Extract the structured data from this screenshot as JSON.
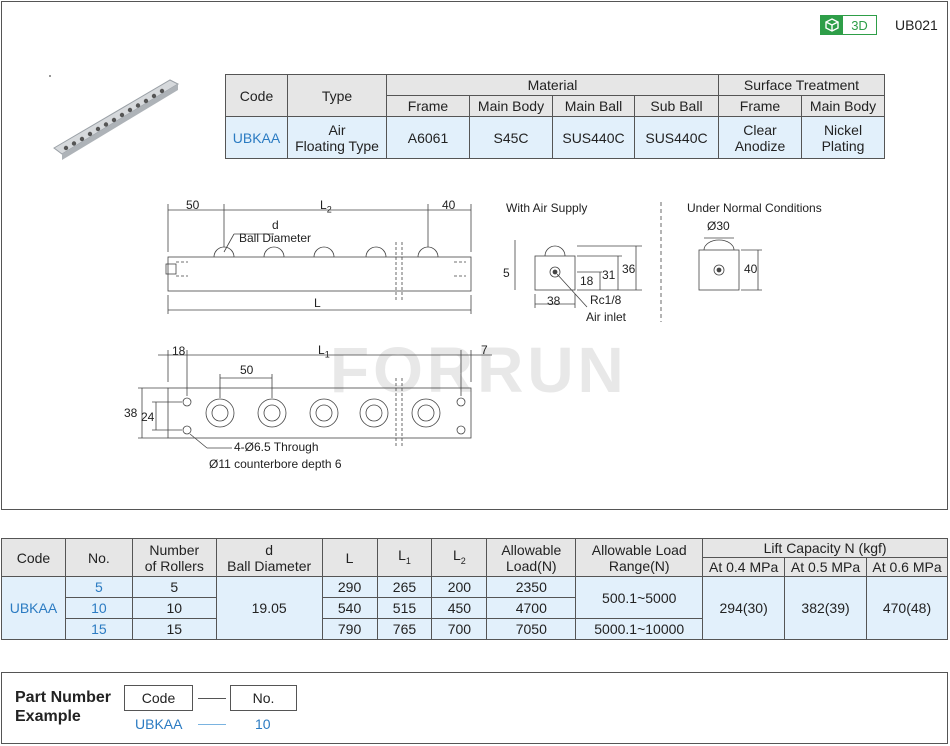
{
  "header": {
    "badge_label": "3D",
    "series_code": "UB021",
    "brand_watermark": "FORRUN",
    "badge_color": "#2e9e48"
  },
  "material_table": {
    "headers": {
      "code": "Code",
      "type": "Type",
      "material": "Material",
      "surface": "Surface Treatment"
    },
    "subheaders": {
      "frame": "Frame",
      "main_body": "Main Body",
      "main_ball": "Main Ball",
      "sub_ball": "Sub Ball",
      "st_frame": "Frame",
      "st_main_body": "Main Body"
    },
    "row": {
      "code": "UBKAA",
      "type_l1": "Air",
      "type_l2": "Floating Type",
      "frame": "A6061",
      "main_body": "S45C",
      "main_ball": "SUS440C",
      "sub_ball": "SUS440C",
      "st_frame_l1": "Clear",
      "st_frame_l2": "Anodize",
      "st_body_l1": "Nickel",
      "st_body_l2": "Plating"
    }
  },
  "drawing": {
    "side": {
      "dim_50": "50",
      "dim_L2": "L",
      "dim_L2_sub": "2",
      "dim_40": "40",
      "d_label": "d",
      "ball_diameter": "Ball Diameter",
      "dim_L": "L"
    },
    "air_supply": {
      "title": "With Air Supply",
      "dim_5": "5",
      "dim_18": "18",
      "dim_31": "31",
      "dim_36": "36",
      "dim_38": "38",
      "rc": "Rc1/8",
      "inlet": "Air inlet"
    },
    "normal": {
      "title": "Under Normal Conditions",
      "dim_30": "Ø30",
      "dim_40": "40"
    },
    "plan": {
      "dim_18": "18",
      "dim_L1": "L",
      "dim_L1_sub": "1",
      "dim_7": "7",
      "dim_50": "50",
      "dim_38": "38",
      "dim_24": "24",
      "hole_l1": "4-Ø6.5 Through",
      "hole_l2": "Ø11 counterbore depth 6"
    }
  },
  "spec_table": {
    "headers": {
      "code": "Code",
      "no": "No.",
      "rollers_l1": "Number",
      "rollers_l2": "of Rollers",
      "d_l1": "d",
      "d_l2": "Ball Diameter",
      "L": "L",
      "L1": "L",
      "L1_sub": "1",
      "L2": "L",
      "L2_sub": "2",
      "allow_l1": "Allowable",
      "allow_l2": "Load(N)",
      "range_l1": "Allowable Load",
      "range_l2": "Range(N)",
      "lift": "Lift Capacity N (kgf)",
      "p04": "At 0.4 MPa",
      "p05": "At 0.5 MPa",
      "p06": "At 0.6 MPa"
    },
    "code": "UBKAA",
    "ball_diameter": "19.05",
    "rows": [
      {
        "no": "5",
        "rollers": "5",
        "L": "290",
        "L1": "265",
        "L2": "200",
        "allow": "2350"
      },
      {
        "no": "10",
        "rollers": "10",
        "L": "540",
        "L1": "515",
        "L2": "450",
        "allow": "4700"
      },
      {
        "no": "15",
        "rollers": "15",
        "L": "790",
        "L1": "765",
        "L2": "700",
        "allow": "7050"
      }
    ],
    "range_a": "500.1~5000",
    "range_b": "5000.1~10000",
    "lift": {
      "p04": "294(30)",
      "p05": "382(39)",
      "p06": "470(48)"
    }
  },
  "part_number": {
    "title_l1": "Part Number",
    "title_l2": "Example",
    "code_label": "Code",
    "no_label": "No.",
    "code_value": "UBKAA",
    "no_value": "10"
  }
}
